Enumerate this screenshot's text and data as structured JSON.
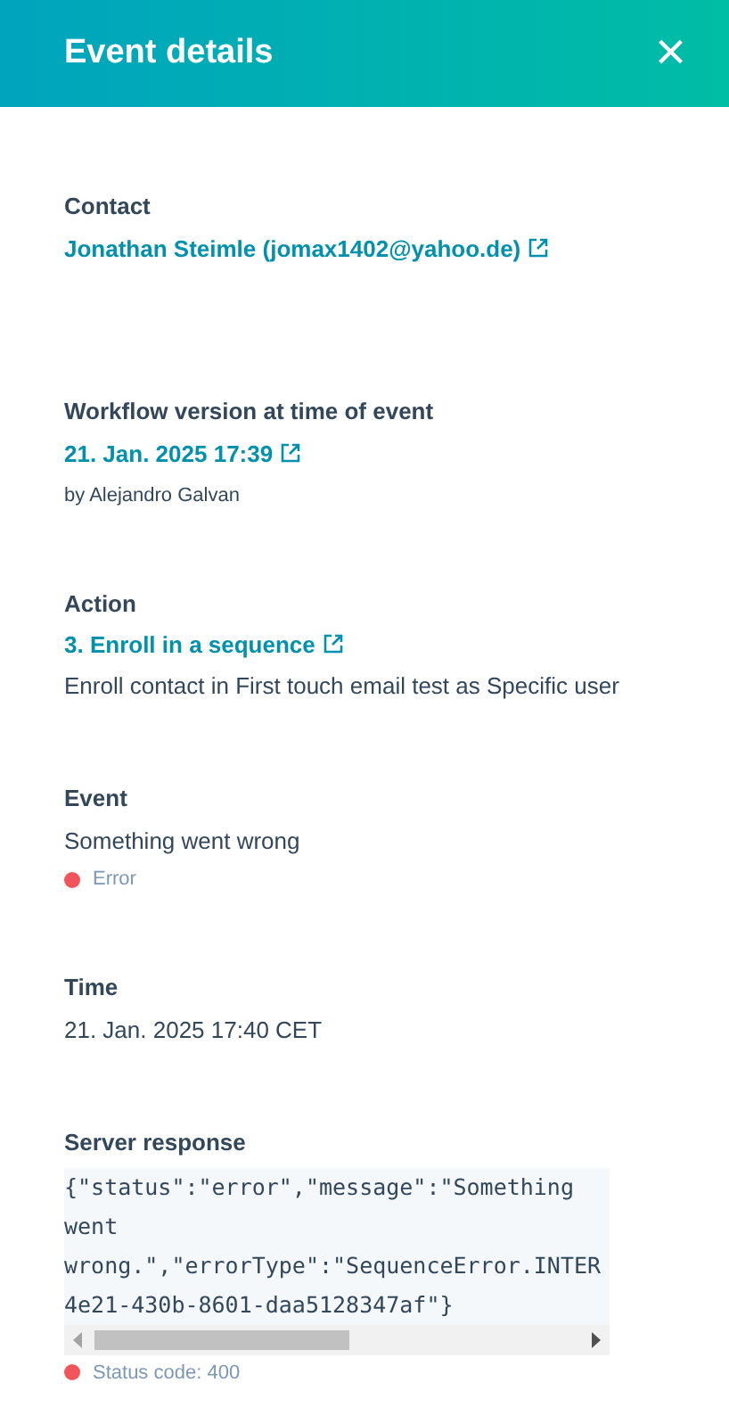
{
  "header": {
    "title": "Event details",
    "close": "×"
  },
  "sections": [
    {
      "label": "Contact",
      "items": [
        {
          "kind": "link",
          "text": "Jonathan Steimle (jomax1402@yahoo.de)"
        }
      ]
    },
    {
      "label": "Workflow version at time of event",
      "items": [
        {
          "kind": "link",
          "text": "21. Jan. 2025 17:39"
        },
        {
          "kind": "note",
          "text": "by Alejandro Galvan"
        }
      ]
    },
    {
      "label": "Action",
      "items": [
        {
          "kind": "link",
          "text": "3. Enroll in a sequence"
        },
        {
          "kind": "text",
          "text": "Enroll contact in First touch email test as Specific user"
        }
      ]
    },
    {
      "label": "Event",
      "items": [
        {
          "kind": "text",
          "text": "Something went wrong"
        },
        {
          "kind": "status",
          "text": "Error",
          "color": "#f2545b"
        }
      ]
    },
    {
      "label": "Time",
      "items": [
        {
          "kind": "text",
          "text": "21. Jan. 2025 17:40 CET"
        }
      ]
    },
    {
      "label": "Server response",
      "items": [
        {
          "kind": "code",
          "lines": [
            "{\"status\":\"error\",\"message\":\"Something",
            "went",
            "wrong.\",\"errorType\":\"SequenceError.INTER",
            "4e21-430b-8601-daa5128347af\"}"
          ]
        },
        {
          "kind": "status",
          "text": "Status code: 400",
          "color": "#f2545b"
        }
      ]
    }
  ]
}
